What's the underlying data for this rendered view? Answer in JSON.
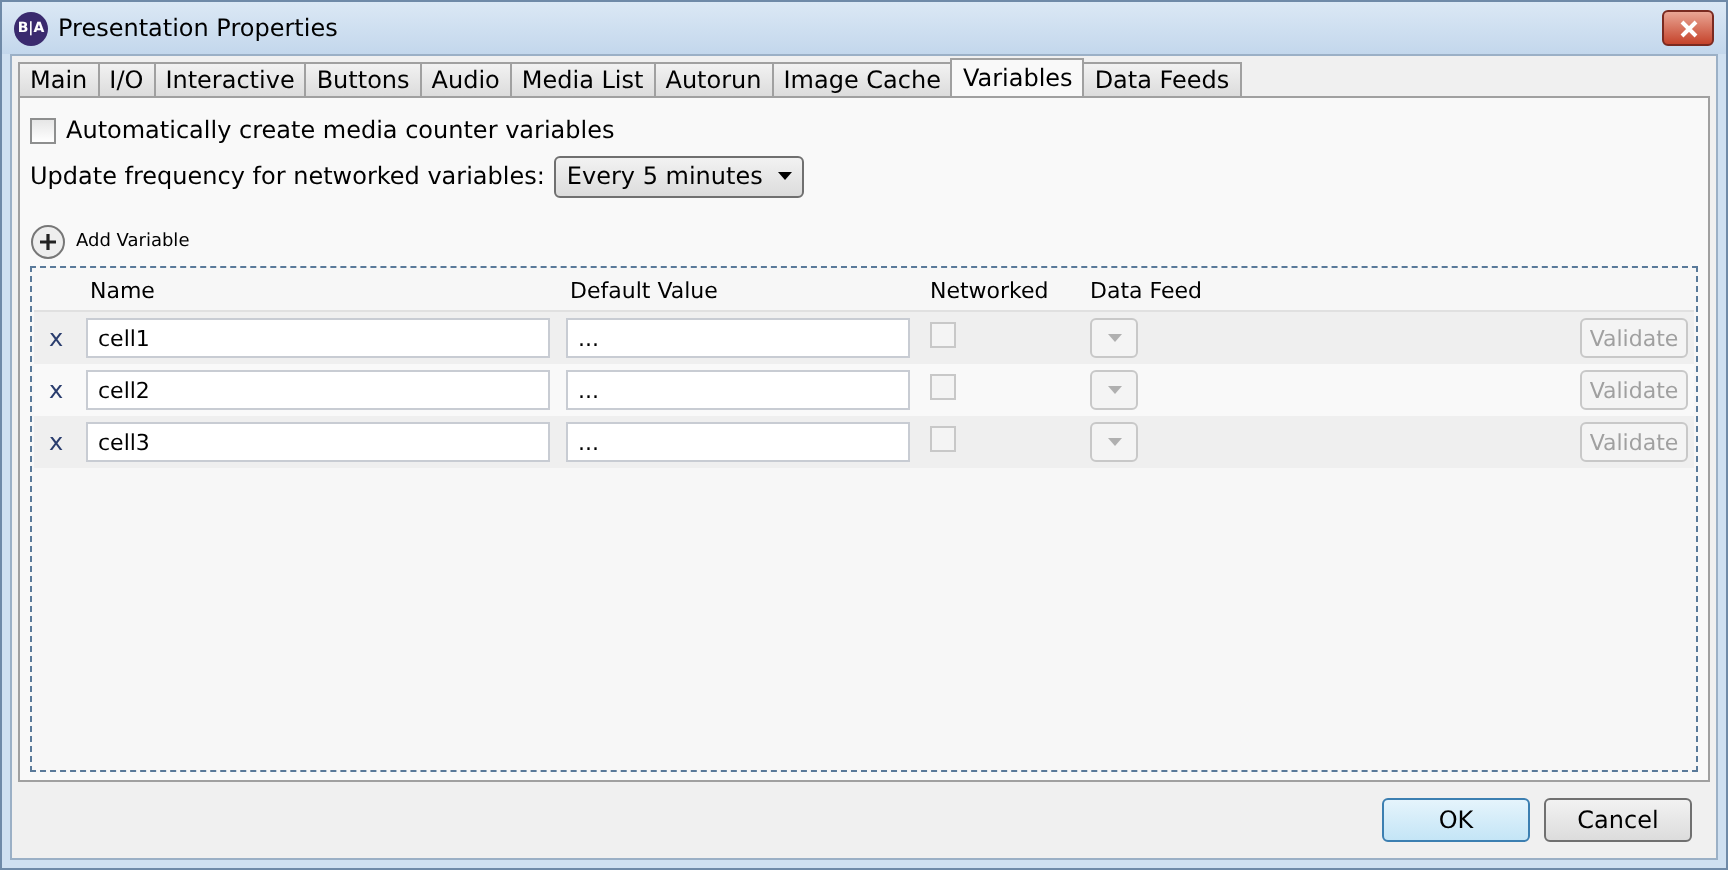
{
  "window": {
    "title": "Presentation Properties",
    "logo": "B|A"
  },
  "tabs": [
    {
      "label": "Main",
      "selected": false
    },
    {
      "label": "I/O",
      "selected": false
    },
    {
      "label": "Interactive",
      "selected": false
    },
    {
      "label": "Buttons",
      "selected": false
    },
    {
      "label": "Audio",
      "selected": false
    },
    {
      "label": "Media List",
      "selected": false
    },
    {
      "label": "Autorun",
      "selected": false
    },
    {
      "label": "Image Cache",
      "selected": false
    },
    {
      "label": "Variables",
      "selected": true
    },
    {
      "label": "Data Feeds",
      "selected": false
    }
  ],
  "auto_create": {
    "label": "Automatically create media counter variables",
    "checked": false
  },
  "update_frequency": {
    "label": "Update frequency for networked variables:",
    "value": "Every 5 minutes"
  },
  "add_variable": {
    "label": "Add Variable"
  },
  "table": {
    "columns": [
      "Name",
      "Default Value",
      "Networked",
      "Data Feed"
    ],
    "rows": [
      {
        "delete": "x",
        "name": "cell1",
        "default_value": "...",
        "networked": false,
        "validate": "Validate",
        "disabled": true
      },
      {
        "delete": "x",
        "name": "cell2",
        "default_value": "...",
        "networked": false,
        "validate": "Validate",
        "disabled": true
      },
      {
        "delete": "x",
        "name": "cell3",
        "default_value": "...",
        "networked": false,
        "validate": "Validate",
        "disabled": true
      }
    ]
  },
  "buttons": [
    {
      "label": "OK",
      "kind": "default"
    },
    {
      "label": "Cancel",
      "kind": "normal"
    }
  ]
}
